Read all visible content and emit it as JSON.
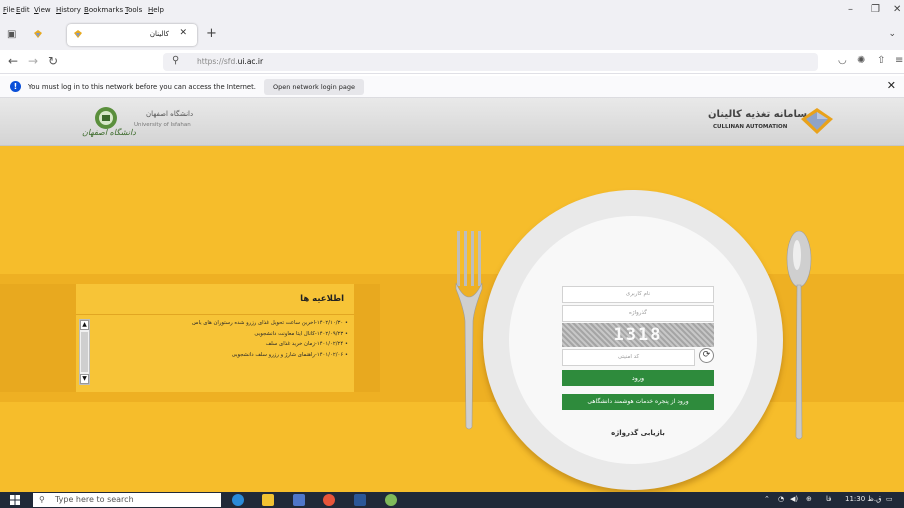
{
  "browser": {
    "menu": [
      "File",
      "Edit",
      "View",
      "History",
      "Bookmarks",
      "Tools",
      "Help"
    ],
    "tab": {
      "title": "کالینان",
      "close_glyph": "✕"
    },
    "new_tab_glyph": "+",
    "url": {
      "scheme": "https://",
      "host": "sfd.",
      "domain": "ui.ac.ir"
    },
    "notification": {
      "message": "You must log in to this network before you can access the Internet.",
      "button": "Open network login page"
    }
  },
  "header": {
    "university_fa": "دانشگاه اصفهان",
    "university_en": "University of Isfahan",
    "university_sign": "دانشگاه اصفهان",
    "brand_fa": "سامانه تغذیه کالینان",
    "brand_en": "CULLINAN AUTOMATION"
  },
  "news": {
    "title": "اطلاعیه ها",
    "items": [
      "۱۴۰۲/۱۰/۳۰-آخرین ساعت تحویل غذای رزرو شده رستوران های یاس",
      "۱۴۰۲/۰۹/۲۳-کانال ایتا معاونت دانشجویی",
      "۱۴۰۱/۰۲/۲۴-زمان خرید غذای سلف",
      "۱۴۰۱/۰۲/۰۶-راهنمای شارژ و رزرو سلف دانشجویی"
    ]
  },
  "login": {
    "username_placeholder": "نام کاربری",
    "password_placeholder": "گذرواژه",
    "captcha_code": "1318",
    "captcha_placeholder": "کد امنیتی",
    "login_button": "ورود",
    "portal_button": "ورود از پنجره خدمات هوشمند دانشگاهی",
    "recover_link": "بازیابی گذرواژه"
  },
  "taskbar": {
    "search_placeholder": "Type here to search",
    "lang": "فا",
    "time": "11:30 ق.ظ"
  },
  "colors": {
    "page_background": "#f6bd2b",
    "button_green": "#2e8b3c",
    "header_grey": "#dedede"
  },
  "icons": [
    "back-icon",
    "forward-icon",
    "reload-icon",
    "search-icon",
    "pocket-icon",
    "extensions-icon",
    "share-icon",
    "info-icon",
    "refresh-icon",
    "windows-icon"
  ]
}
